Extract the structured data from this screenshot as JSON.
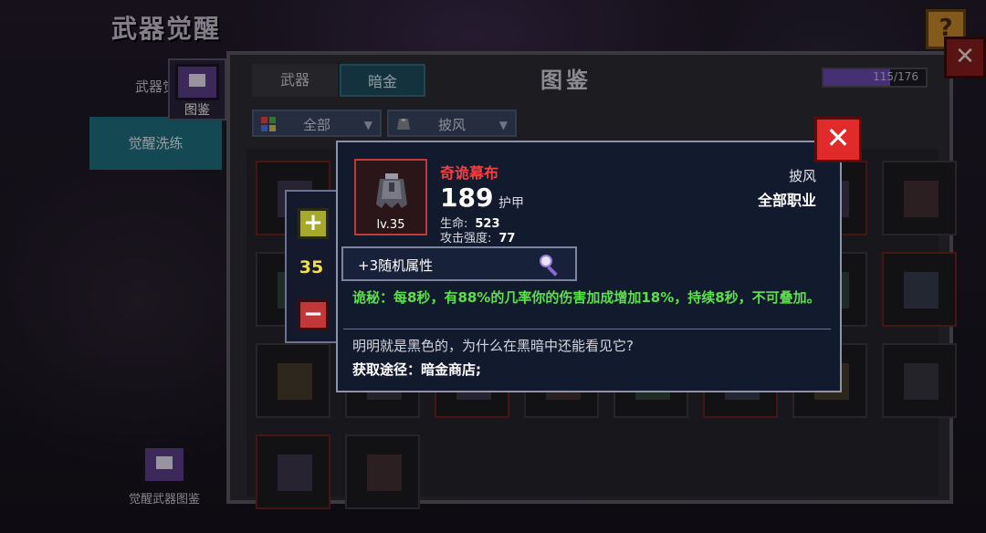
{
  "page": {
    "title": "武器觉醒",
    "help_label": "?"
  },
  "sidebar": {
    "items": [
      {
        "label": "武器觉"
      },
      {
        "label": "觉醒洗练"
      }
    ],
    "codex_shortcut_label": "图鉴",
    "bottom_codex_label": "觉醒武器图鉴"
  },
  "codex": {
    "title": "图鉴",
    "tabs": [
      {
        "label": "武器"
      },
      {
        "label": "暗金"
      }
    ],
    "progress": {
      "text": "115/176",
      "value": 115,
      "max": 176
    },
    "filters": {
      "category": "全部",
      "type": "披风"
    },
    "close_label": "✕"
  },
  "stepper": {
    "value": "35",
    "plus_label": "+",
    "minus_label": "−"
  },
  "item": {
    "name": "奇诡幕布",
    "level": "lv.35",
    "armor_value": "189",
    "armor_label": "护甲",
    "stats": [
      {
        "label": "生命:",
        "value": "523"
      },
      {
        "label": "攻击强度:",
        "value": "77"
      }
    ],
    "type": "披风",
    "class": "全部职业",
    "random_attr": "+3随机属性",
    "effect": "诡秘：每8秒，有88%的几率你的伤害加成增加18%，持续8秒，不可叠加。",
    "flavor": "明明就是黑色的，为什么在黑暗中还能看见它?",
    "obtain": "获取途径：暗金商店;",
    "close_label": "✕"
  },
  "colors": {
    "item_name": "#ef4044",
    "effect": "#5be04a",
    "stepper_value": "#f1df4a"
  }
}
